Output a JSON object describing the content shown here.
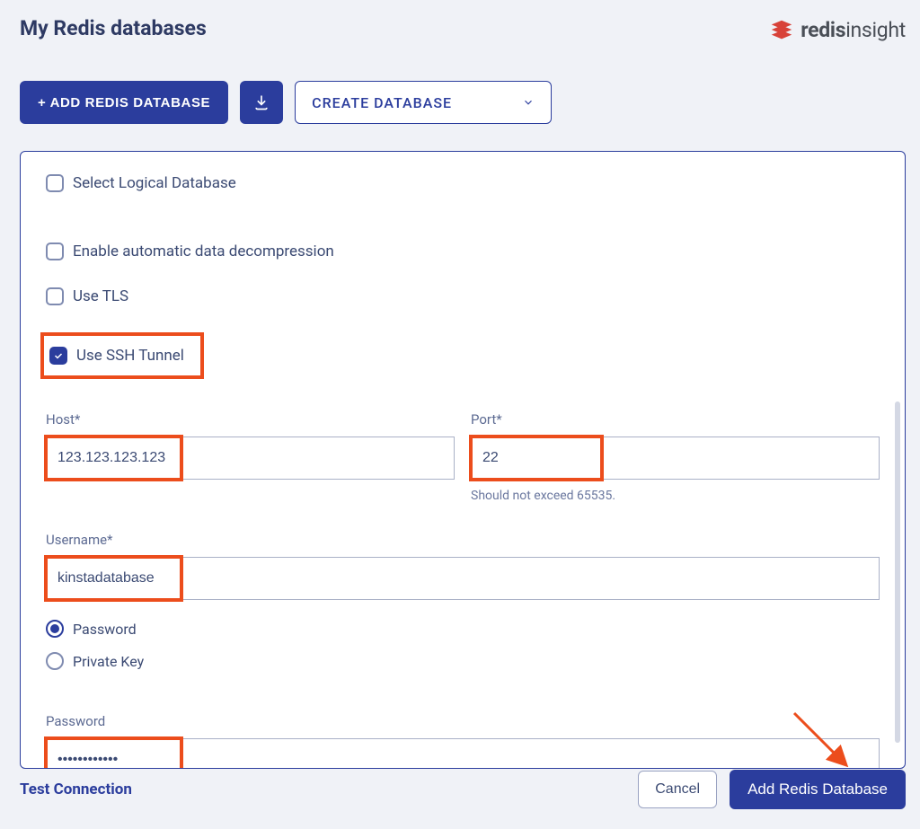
{
  "header": {
    "title": "My Redis databases",
    "brand_bold": "redis",
    "brand_light": "insight"
  },
  "toolbar": {
    "add_label": "+ ADD REDIS DATABASE",
    "dropdown_label": "CREATE DATABASE"
  },
  "form": {
    "checkboxes": {
      "logical_db": "Select Logical Database",
      "auto_decompress": "Enable automatic data decompression",
      "use_tls": "Use TLS",
      "use_ssh": "Use SSH Tunnel"
    },
    "host": {
      "label": "Host*",
      "value": "123.123.123.123"
    },
    "port": {
      "label": "Port*",
      "value": "22",
      "helper": "Should not exceed 65535."
    },
    "username": {
      "label": "Username*",
      "value": "kinstadatabase"
    },
    "auth_options": {
      "password": "Password",
      "private_key": "Private Key"
    },
    "password": {
      "label": "Password",
      "value": "••••••••••••"
    }
  },
  "footer": {
    "test": "Test Connection",
    "cancel": "Cancel",
    "submit": "Add Redis Database"
  },
  "colors": {
    "primary": "#2b3d9d",
    "highlight": "#ec4d1c"
  }
}
